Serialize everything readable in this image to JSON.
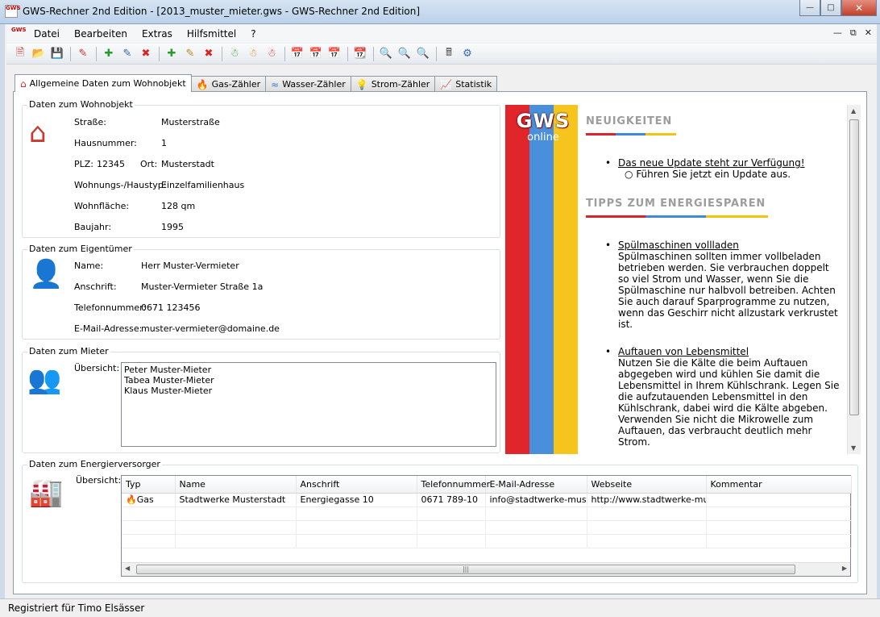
{
  "window": {
    "title": "GWS-Rechner 2nd Edition - [2013_muster_mieter.gws - GWS-Rechner 2nd Edition]",
    "app_icon_text": "GWS"
  },
  "menu": {
    "items": [
      "Datei",
      "Bearbeiten",
      "Extras",
      "Hilfsmittel",
      "?"
    ]
  },
  "tabs": [
    {
      "label": "Allgemeine Daten zum Wohnobjekt",
      "icon": "house-icon"
    },
    {
      "label": "Gas-Zähler",
      "icon": "flame-icon"
    },
    {
      "label": "Wasser-Zähler",
      "icon": "water-icon"
    },
    {
      "label": "Strom-Zähler",
      "icon": "bulb-icon"
    },
    {
      "label": "Statistik",
      "icon": "chart-icon"
    }
  ],
  "wohnobjekt": {
    "legend": "Daten zum Wohnobjekt",
    "strasse_label": "Straße:",
    "strasse": "Musterstraße",
    "hausnummer_label": "Hausnummer:",
    "hausnummer": "1",
    "plz_label": "PLZ:",
    "plz": "12345",
    "ort_label": "Ort:",
    "ort": "Musterstadt",
    "typ_label": "Wohnungs-/Haustyp:",
    "typ": "Einzelfamilienhaus",
    "flaeche_label": "Wohnfläche:",
    "flaeche": "128 qm",
    "baujahr_label": "Baujahr:",
    "baujahr": "1995"
  },
  "eigentuemer": {
    "legend": "Daten zum Eigentümer",
    "name_label": "Name:",
    "name": "Herr Muster-Vermieter",
    "anschrift_label": "Anschrift:",
    "anschrift": "Muster-Vermieter Straße 1a",
    "telefon_label": "Telefonnummer:",
    "telefon": "0671 123456",
    "email_label": "E-Mail-Adresse:",
    "email": "muster-vermieter@domaine.de"
  },
  "mieter": {
    "legend": "Daten zum Mieter",
    "uebersicht_label": "Übersicht:",
    "list": [
      "Peter Muster-Mieter",
      "Tabea Muster-Mieter",
      "Klaus Muster-Mieter"
    ]
  },
  "versorger": {
    "legend": "Daten zum Energierversorger",
    "uebersicht_label": "Übersicht:",
    "columns": [
      "Typ",
      "Name",
      "Anschrift",
      "Telefonnummer",
      "E-Mail-Adresse",
      "Webseite",
      "Kommentar"
    ],
    "rows": [
      [
        "Gas",
        "Stadtwerke Musterstadt",
        "Energiegasse 10",
        "0671 789-10",
        "info@stadtwerke-must...",
        "http://www.stadtwerke-mu...",
        ""
      ]
    ]
  },
  "news": {
    "logo": "GWS",
    "logo_sub": "online",
    "heading1": "NEUIGKEITEN",
    "update_link": "Das neue Update steht zur Verfügung!",
    "update_sub": "Führen Sie jetzt ein Update aus.",
    "heading2": "TIPPS ZUM ENERGIESPAREN",
    "tip1_title": "Spülmaschinen vollladen",
    "tip1_text": "Spülmaschinen sollten immer vollbeladen betrieben werden. Sie verbrauchen doppelt so viel Strom und Wasser, wenn Sie die Spülmaschine nur halbvoll betreiben. Achten Sie auch darauf Sparprogramme zu nutzen, wenn das Geschirr nicht allzustark verkrustet ist.",
    "tip2_title": "Auftauen von Lebensmittel",
    "tip2_text": "Nutzen Sie die Kälte die beim Auftauen abgegeben wird und kühlen Sie damit die Lebensmittel in Ihrem Kühlschrank. Legen Sie die aufzutauenden Lebensmittel in den Kühlschrank, dabei wird die Kälte abgeben. Verwenden Sie nicht die Mikrowelle zum Auftauen, das verbraucht deutlich mehr Strom."
  },
  "colors": {
    "stripe_red": "#e0252b",
    "stripe_blue": "#4a8fdb",
    "stripe_yellow": "#f5c51d",
    "heading_underline_red": "#d8262a",
    "heading_underline_blue": "#3c8ad8",
    "heading_underline_yellow": "#f3c40f"
  },
  "statusbar": {
    "text": "Registriert für Timo Elsässer"
  }
}
